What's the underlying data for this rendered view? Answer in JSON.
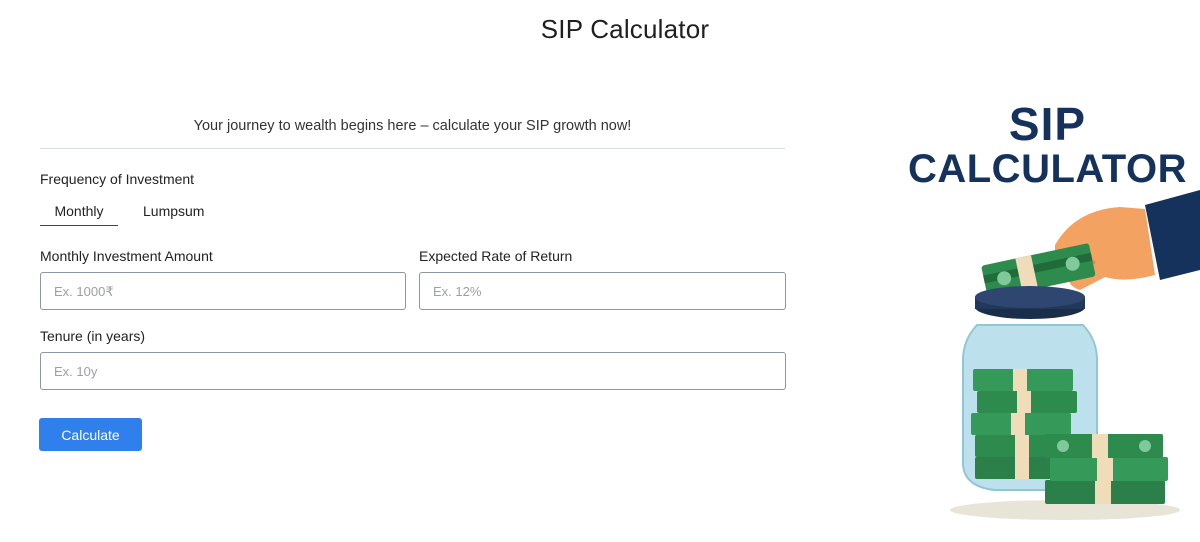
{
  "page": {
    "title": "SIP Calculator"
  },
  "tagline": "Your journey to wealth begins here – calculate your SIP growth now!",
  "frequency": {
    "label": "Frequency of Investment",
    "tabs": [
      {
        "label": "Monthly",
        "active": true
      },
      {
        "label": "Lumpsum",
        "active": false
      }
    ]
  },
  "fields": {
    "monthly_amount": {
      "label": "Monthly Investment Amount",
      "placeholder": "Ex. 1000₹",
      "value": ""
    },
    "rate": {
      "label": "Expected Rate of Return",
      "placeholder": "Ex. 12%",
      "value": ""
    },
    "tenure": {
      "label": "Tenure (in years)",
      "placeholder": "Ex. 10y",
      "value": ""
    }
  },
  "actions": {
    "calculate_label": "Calculate"
  },
  "hero": {
    "line1": "SIP",
    "line2": "CALCULATOR"
  },
  "colors": {
    "accent": "#2f80ed",
    "hero_text": "#15325c",
    "money": "#2e8b4e",
    "jar": "#8fc9d8"
  }
}
